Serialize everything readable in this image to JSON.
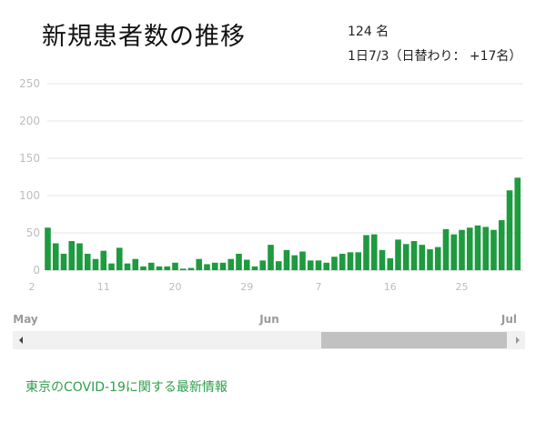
{
  "header": {
    "title": "新規患者数の推移",
    "count_text": "124 名",
    "date_text": "1日7/3（日替わり： +17名）"
  },
  "footer": {
    "link_text": "東京のCOVID-19に関する最新情報"
  },
  "colors": {
    "bar": "#1e9a3f",
    "grid": "#e6e6e6",
    "axis_text": "#bdbdbd",
    "link": "#2e9e4a"
  },
  "chart_data": {
    "type": "bar",
    "x_start": "2020-05-02",
    "x_end": "2020-07-03",
    "values": [
      57,
      36,
      22,
      39,
      36,
      22,
      15,
      26,
      9,
      30,
      9,
      15,
      5,
      10,
      5,
      5,
      10,
      2,
      3,
      15,
      8,
      10,
      10,
      15,
      22,
      14,
      5,
      13,
      34,
      12,
      27,
      20,
      25,
      13,
      13,
      10,
      18,
      22,
      24,
      24,
      47,
      48,
      27,
      16,
      41,
      35,
      39,
      34,
      28,
      31,
      55,
      48,
      54,
      57,
      60,
      58,
      54,
      67,
      107,
      124
    ],
    "ylim": [
      0,
      250
    ],
    "yticks": [
      0,
      50,
      100,
      150,
      200,
      250
    ],
    "xtick_labels": [
      "2",
      "11",
      "20",
      "29",
      "7",
      "16",
      "25"
    ],
    "month_labels": [
      "May",
      "Jun",
      "Jul"
    ],
    "grid": true,
    "legend": "none"
  }
}
